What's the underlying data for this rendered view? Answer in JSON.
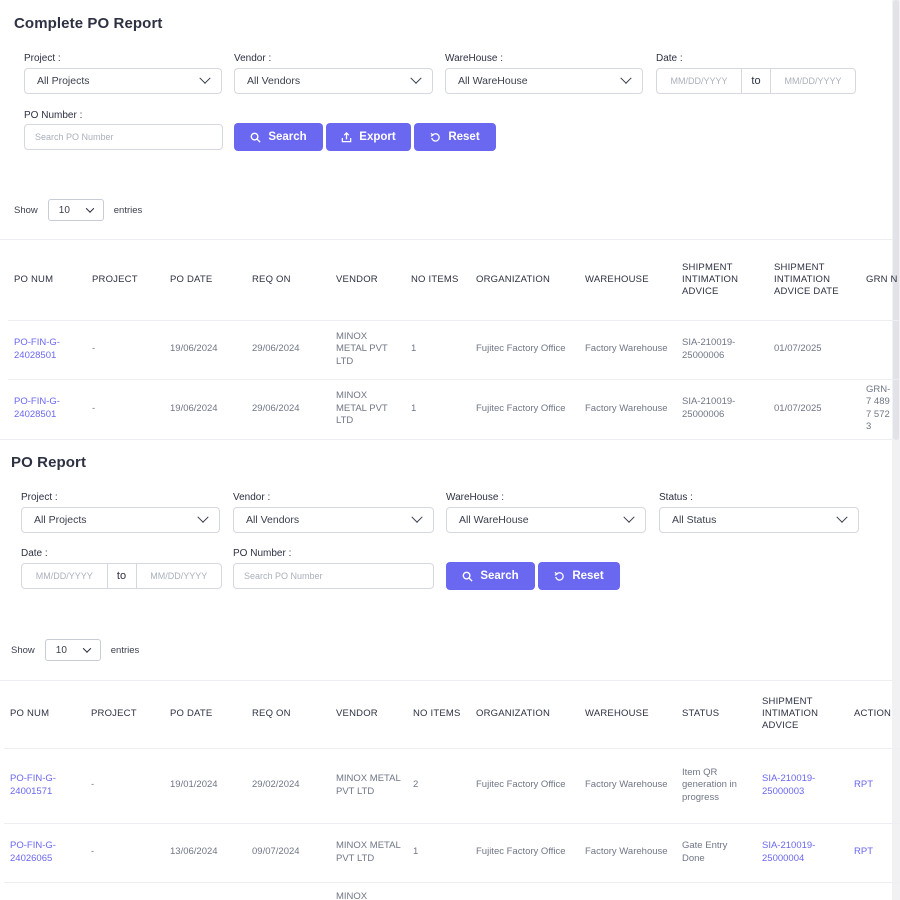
{
  "complete_report": {
    "title": "Complete PO Report",
    "project_label": "Project :",
    "project_value": "All Projects",
    "vendor_label": "Vendor :",
    "vendor_value": "All Vendors",
    "warehouse_label": "WareHouse :",
    "warehouse_value": "All WareHouse",
    "date_label": "Date :",
    "date_from_placeholder": "MM/DD/YYYY",
    "date_to_word": "to",
    "date_to_placeholder": "MM/DD/YYYY",
    "po_number_label": "PO Number :",
    "po_number_placeholder": "Search PO Number",
    "search_label": "Search",
    "export_label": "Export",
    "reset_label": "Reset",
    "show_label": "Show",
    "show_value": "10",
    "entries_label": "entries",
    "columns": [
      "PO NUM",
      "PROJECT",
      "PO DATE",
      "REQ ON",
      "VENDOR",
      "NO ITEMS",
      "ORGANIZATION",
      "WAREHOUSE",
      "SHIPMENT INTIMATION ADVICE",
      "SHIPMENT INTIMATION ADVICE DATE",
      "GRN N"
    ],
    "rows": [
      [
        "PO-FIN-G-24028501",
        "-",
        "19/06/2024",
        "29/06/2024",
        "MINOX METAL PVT LTD",
        "1",
        "Fujitec Factory Office",
        "Factory Warehouse",
        "SIA-210019-25000006",
        "01/07/2025",
        ""
      ],
      [
        "PO-FIN-G-24028501",
        "-",
        "19/06/2024",
        "29/06/2024",
        "MINOX METAL PVT LTD",
        "1",
        "Fujitec Factory Office",
        "Factory Warehouse",
        "SIA-210019-25000006",
        "01/07/2025",
        "GRN-7 4897 5723"
      ]
    ]
  },
  "po_report": {
    "title": "PO Report",
    "project_label": "Project :",
    "project_value": "All Projects",
    "vendor_label": "Vendor :",
    "vendor_value": "All Vendors",
    "warehouse_label": "WareHouse :",
    "warehouse_value": "All WareHouse",
    "status_label": "Status :",
    "status_value": "All Status",
    "date_label": "Date :",
    "date_from_placeholder": "MM/DD/YYYY",
    "date_to_word": "to",
    "date_to_placeholder": "MM/DD/YYYY",
    "po_number_label": "PO Number :",
    "po_number_placeholder": "Search PO Number",
    "search_label": "Search",
    "reset_label": "Reset",
    "show_label": "Show",
    "show_value": "10",
    "entries_label": "entries",
    "columns": [
      "PO NUM",
      "PROJECT",
      "PO DATE",
      "REQ ON",
      "VENDOR",
      "NO ITEMS",
      "ORGANIZATION",
      "WAREHOUSE",
      "STATUS",
      "SHIPMENT INTIMATION ADVICE",
      "ACTION"
    ],
    "rows": [
      [
        "PO-FIN-G-24001571",
        "-",
        "19/01/2024",
        "29/02/2024",
        "MINOX METAL PVT LTD",
        "2",
        "Fujitec Factory Office",
        "Factory Warehouse",
        "Item QR generation in progress",
        "SIA-210019-25000003",
        "RPT"
      ],
      [
        "PO-FIN-G-24026065",
        "-",
        "13/06/2024",
        "09/07/2024",
        "MINOX METAL PVT LTD",
        "1",
        "Fujitec Factory Office",
        "Factory Warehouse",
        "Gate Entry Done",
        "SIA-210019-25000004",
        "RPT"
      ],
      [
        "",
        "",
        "",
        "",
        "MINOX",
        "",
        "",
        "",
        "",
        "",
        ""
      ]
    ]
  },
  "colors": {
    "accent": "#6a67f0",
    "text": "#2d3142",
    "muted": "#707686",
    "border": "#d6d8e1"
  },
  "icons": {
    "search": "search-icon",
    "export": "export-icon",
    "reset": "reset-icon",
    "chevron": "chevron-down-icon"
  }
}
